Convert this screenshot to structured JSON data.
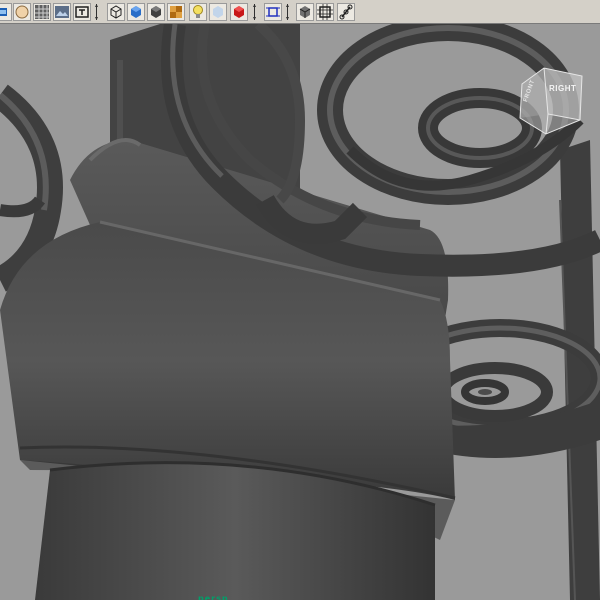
{
  "toolbar": {
    "buttons": [
      {
        "name": "select-camera-icon"
      },
      {
        "name": "camera-attributes-icon"
      },
      {
        "name": "grid-toggle-icon"
      },
      {
        "name": "image-plane-icon"
      },
      {
        "name": "resolution-gate-icon"
      },
      {
        "name": "wireframe-shading-icon"
      },
      {
        "name": "smooth-shade-all-icon"
      },
      {
        "name": "default-material-icon"
      },
      {
        "name": "textured-icon"
      },
      {
        "name": "use-all-lights-icon"
      },
      {
        "name": "xray-icon"
      },
      {
        "name": "shadows-icon"
      },
      {
        "name": "isolate-select-icon"
      },
      {
        "name": "wireframe-on-shaded-icon"
      },
      {
        "name": "film-gate-icon"
      },
      {
        "name": "joints-icon"
      }
    ]
  },
  "viewcube": {
    "right_label": "RIGHT",
    "front_label": "FRONT"
  },
  "viewport": {
    "camera_label": "persp"
  },
  "colors": {
    "viewport_bg": "#9a9a9a",
    "toolbar_bg": "#d4d0c8",
    "model_dark": "#3c3c3c",
    "model_mid": "#4a4a4a",
    "model_light": "#5c5c5c",
    "camera_label": "#00a06a"
  }
}
